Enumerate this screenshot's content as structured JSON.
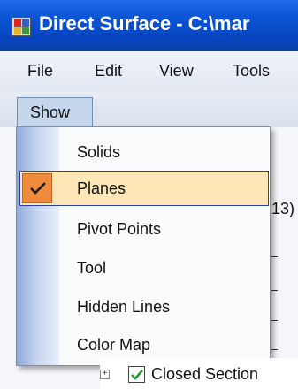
{
  "window": {
    "title": "Direct Surface - C:\\mar",
    "icon": "app-icon"
  },
  "menubar": {
    "items": [
      "File",
      "Edit",
      "View",
      "Tools"
    ]
  },
  "toolstrip": {
    "show_label": "Show"
  },
  "show_menu": {
    "items": [
      {
        "label": "Solids",
        "checked": false
      },
      {
        "label": "Planes",
        "checked": true
      },
      {
        "label": "Pivot Points",
        "checked": false
      },
      {
        "label": "Tool",
        "checked": false
      },
      {
        "label": "Hidden Lines",
        "checked": false
      },
      {
        "label": "Color Map",
        "checked": false
      }
    ],
    "colors": {
      "highlight": "#fde7b6",
      "highlight_border": "#2d3fa2",
      "check_background": "#f08a3c"
    }
  },
  "background": {
    "peek_text": "13)",
    "tree_item": {
      "label": "Closed Section",
      "checked": true,
      "expander": "+"
    }
  },
  "colors": {
    "titlebar": "#0a54d4",
    "menubar": "#e6ecf4"
  }
}
